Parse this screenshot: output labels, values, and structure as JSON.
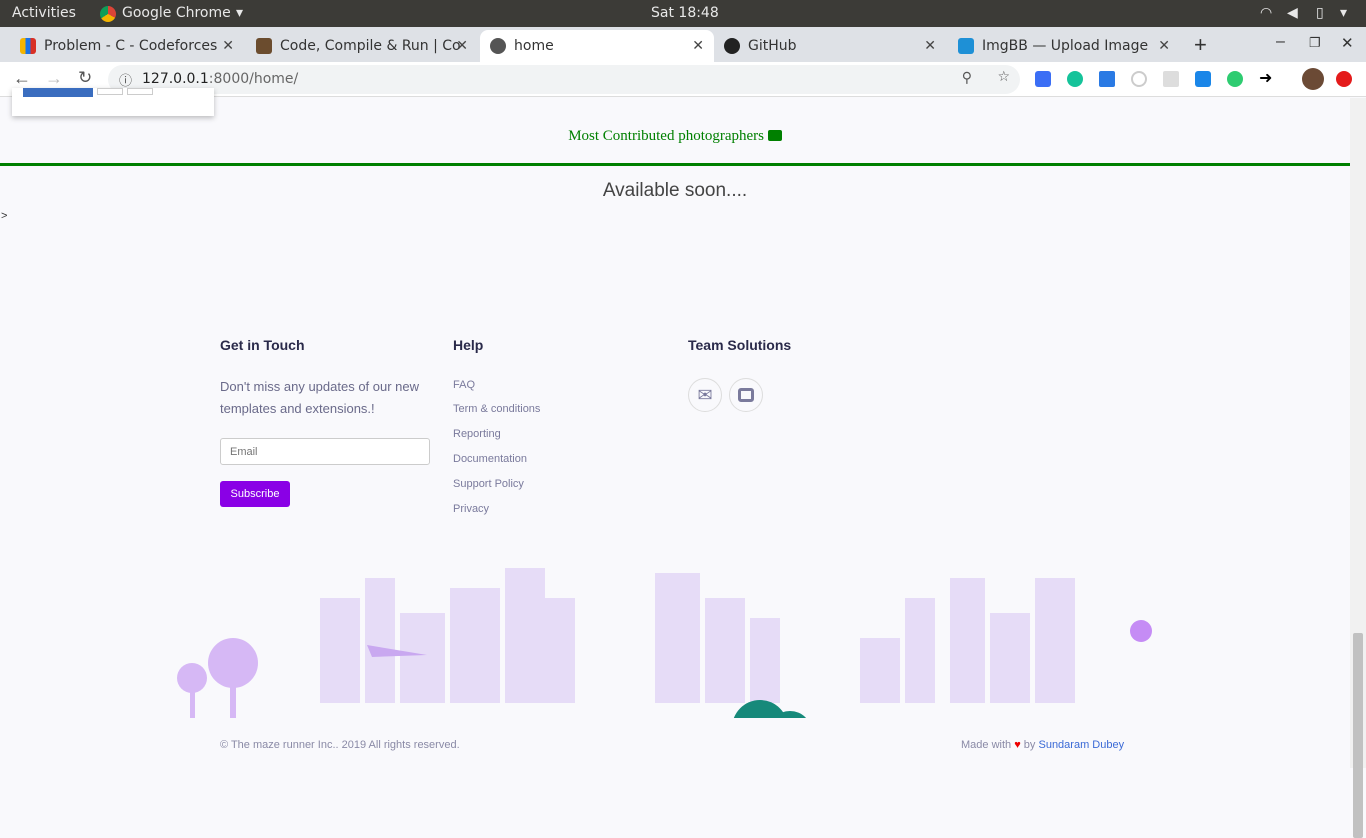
{
  "os_bar": {
    "activities": "Activities",
    "app": "Google Chrome",
    "clock": "Sat 18:48"
  },
  "tabs": [
    {
      "title": "Problem - C - Codeforces",
      "icon": "codeforces-icon"
    },
    {
      "title": "Code, Compile & Run | Co",
      "icon": "codechef-cc-icon"
    },
    {
      "title": "home",
      "icon": "globe-icon",
      "active": true
    },
    {
      "title": "GitHub",
      "icon": "github-icon"
    },
    {
      "title": "ImgBB — Upload Image",
      "icon": "imgbb-icon"
    }
  ],
  "address": {
    "host": "127.0.0.1",
    "rest": ":8000/home/"
  },
  "page": {
    "photographers": "Most Contributed photographers",
    "available": "Available soon....",
    "stray": ">",
    "accent": "#008000"
  },
  "footer": {
    "touch_title": "Get in Touch",
    "touch_text": "Don't miss any updates of our new templates and extensions.!",
    "email_placeholder": "Email",
    "subscribe": "Subscribe",
    "help_title": "Help",
    "help_links": [
      "FAQ",
      "Term & conditions",
      "Reporting",
      "Documentation",
      "Support Policy",
      "Privacy"
    ],
    "team_title": "Team Solutions",
    "copyright": "© The maze runner Inc.. 2019 All rights reserved.",
    "made_with": "Made with",
    "by": "by",
    "author": "Sundaram Dubey",
    "button_color": "#8a00e6"
  }
}
